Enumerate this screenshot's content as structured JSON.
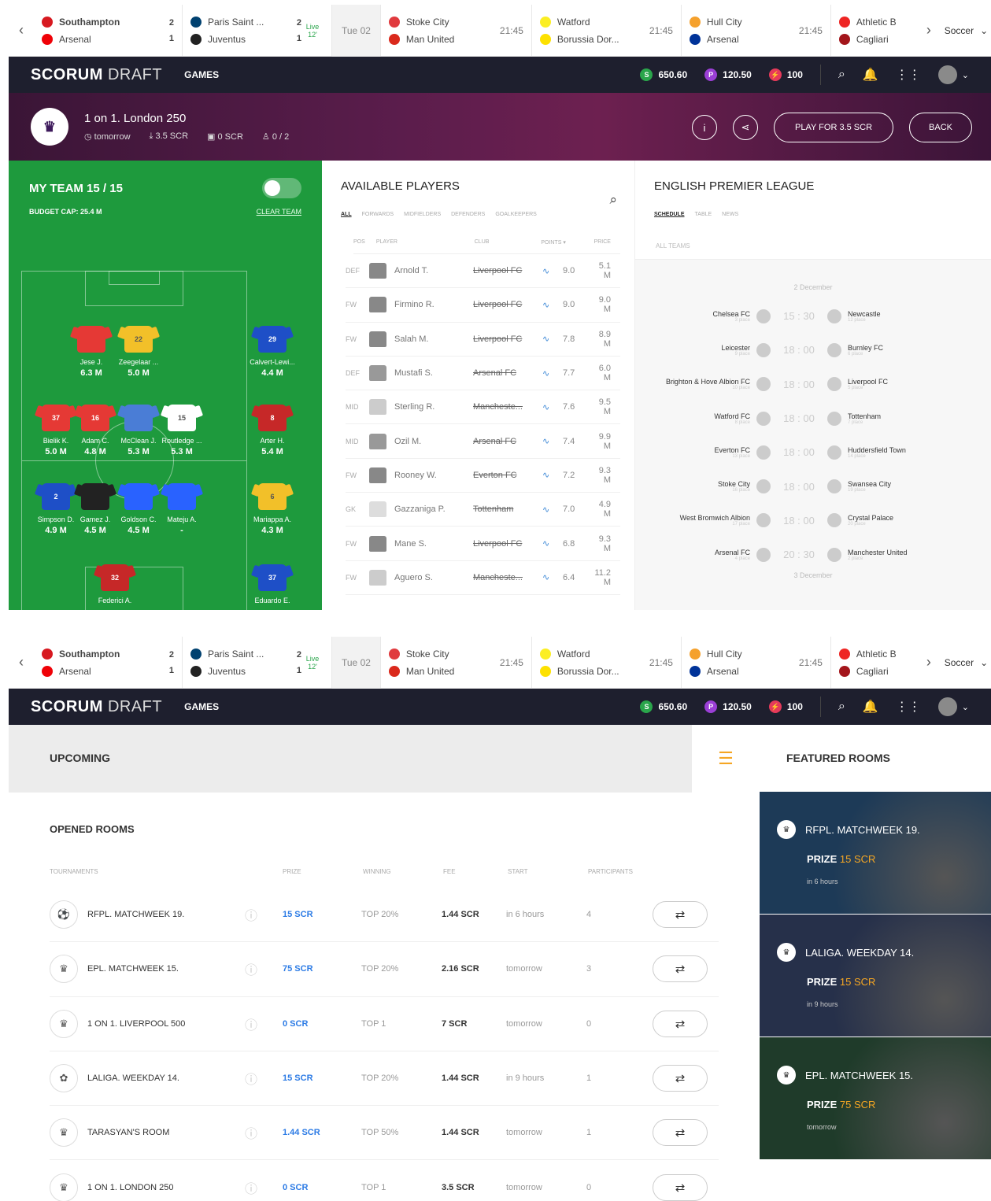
{
  "ticker": {
    "matches": [
      {
        "home": "Southampton",
        "away": "Arsenal",
        "home_score": "2",
        "away_score": "1",
        "status": "",
        "home_color": "#d71920",
        "away_color": "#ef0107"
      },
      {
        "home": "Paris Saint ...",
        "away": "Juventus",
        "home_score": "2",
        "away_score": "1",
        "status": "Live\n12'",
        "home_color": "#004170",
        "away_color": "#222222"
      },
      {
        "home": "Stoke City",
        "away": "Man United",
        "home_score": "",
        "away_score": "",
        "status": "21:45",
        "home_color": "#e03a3e",
        "away_color": "#da291c"
      },
      {
        "home": "Watford",
        "away": "Borussia Dor...",
        "home_score": "",
        "away_score": "",
        "status": "21:45",
        "home_color": "#fbee23",
        "away_color": "#fde100"
      },
      {
        "home": "Hull City",
        "away": "Arsenal",
        "home_score": "",
        "away_score": "",
        "status": "21:45",
        "home_color": "#f5a12d",
        "away_color": "#003399"
      },
      {
        "home": "Athletic B",
        "away": "Cagliari",
        "home_score": "",
        "away_score": "",
        "status": "",
        "home_color": "#ee2523",
        "away_color": "#a3151b"
      }
    ],
    "date_label": "Tue 02",
    "sport": "Soccer"
  },
  "nav": {
    "logo_bold": "SCORUM",
    "logo_light": "DRAFT",
    "games": "GAMES",
    "balance_scr": "650.60",
    "balance_p": "120.50",
    "balance_bolt": "100",
    "colors": {
      "scr": "#2aa54b",
      "p": "#9b3fd6",
      "bolt": "#e63a5a"
    }
  },
  "banner": {
    "title": "1 on 1. London 250",
    "start": "tomorrow",
    "fee": "3.5 SCR",
    "prize": "0 SCR",
    "participants": "0 / 2",
    "play_button": "PLAY FOR 3.5 SCR",
    "back_button": "BACK"
  },
  "team": {
    "title": "MY TEAM 15 / 15",
    "budget": "BUDGET CAP: 25.4 M",
    "clear": "CLEAR TEAM",
    "players": [
      {
        "name": "Jese J.",
        "price": "6.3 M",
        "num": "",
        "color": "#e53935"
      },
      {
        "name": "Zeegelaar ...",
        "price": "5.0 M",
        "num": "22",
        "color": "#f2c029"
      },
      {
        "name": "Calvert-Lewi...",
        "price": "4.4 M",
        "num": "29",
        "color": "#1e4fc7"
      },
      {
        "name": "Bielik K.",
        "price": "5.0 M",
        "num": "37",
        "color": "#e53935"
      },
      {
        "name": "Adam C.",
        "price": "4.8 M",
        "num": "16",
        "color": "#e53935"
      },
      {
        "name": "McClean J.",
        "price": "5.3 M",
        "num": "",
        "color": "#4a7dd6"
      },
      {
        "name": "Routledge ...",
        "price": "5.3 M",
        "num": "15",
        "color": "#ffffff"
      },
      {
        "name": "Arter H.",
        "price": "5.4 M",
        "num": "8",
        "color": "#c62828"
      },
      {
        "name": "Simpson D.",
        "price": "4.9 M",
        "num": "2",
        "color": "#1e4fc7"
      },
      {
        "name": "Gamez J.",
        "price": "4.5 M",
        "num": "",
        "color": "#222222"
      },
      {
        "name": "Goldson C.",
        "price": "4.5 M",
        "num": "",
        "color": "#2962ff"
      },
      {
        "name": "Mateju A.",
        "price": "-",
        "num": "",
        "color": "#2962ff"
      },
      {
        "name": "Mariappa A.",
        "price": "4.3 M",
        "num": "6",
        "color": "#f2c029"
      },
      {
        "name": "Federici A.",
        "price": "",
        "num": "32",
        "color": "#c62828"
      },
      {
        "name": "Eduardo E.",
        "price": "",
        "num": "37",
        "color": "#1e4fc7"
      }
    ]
  },
  "available": {
    "title": "AVAILABLE PLAYERS",
    "tabs": [
      "ALL",
      "FORWARDS",
      "MIDFIELDERS",
      "DEFENDERS",
      "GOALKEEPERS"
    ],
    "headers": [
      "POS",
      "PLAYER",
      "CLUB",
      "POINTS ▾",
      "PRICE"
    ],
    "players": [
      {
        "pos": "DEF",
        "name": "Arnold T.",
        "club": "Liverpool FC",
        "points": "9.0",
        "price": "5.1 M",
        "kit": "#888888"
      },
      {
        "pos": "FW",
        "name": "Firmino R.",
        "club": "Liverpool FC",
        "points": "9.0",
        "price": "9.0 M",
        "kit": "#888888"
      },
      {
        "pos": "FW",
        "name": "Salah M.",
        "club": "Liverpool FC",
        "points": "7.8",
        "price": "8.9 M",
        "kit": "#888888"
      },
      {
        "pos": "DEF",
        "name": "Mustafi S.",
        "club": "Arsenal FC",
        "points": "7.7",
        "price": "6.0 M",
        "kit": "#999999"
      },
      {
        "pos": "MID",
        "name": "Sterling R.",
        "club": "Mancheste...",
        "points": "7.6",
        "price": "9.5 M",
        "kit": "#cccccc"
      },
      {
        "pos": "MID",
        "name": "Ozil M.",
        "club": "Arsenal FC",
        "points": "7.4",
        "price": "9.9 M",
        "kit": "#999999"
      },
      {
        "pos": "FW",
        "name": "Rooney W.",
        "club": "Everton FC",
        "points": "7.2",
        "price": "9.3 M",
        "kit": "#888888"
      },
      {
        "pos": "GK",
        "name": "Gazzaniga P.",
        "club": "Tottenham",
        "points": "7.0",
        "price": "4.9 M",
        "kit": "#dddddd"
      },
      {
        "pos": "FW",
        "name": "Mane S.",
        "club": "Liverpool FC",
        "points": "6.8",
        "price": "9.3 M",
        "kit": "#888888"
      },
      {
        "pos": "FW",
        "name": "Aguero S.",
        "club": "Mancheste...",
        "points": "6.4",
        "price": "11.2 M",
        "kit": "#cccccc"
      }
    ]
  },
  "league": {
    "title": "ENGLISH PREMIER LEAGUE",
    "tabs": [
      "SCHEDULE",
      "TABLE",
      "NEWS"
    ],
    "filter": "ALL TEAMS",
    "date1": "2 December",
    "date2": "3 December",
    "fixtures": [
      {
        "home": "Chelsea FC",
        "home_place": "3 place",
        "time": "15 : 30",
        "away": "Newcastle",
        "away_place": "12 place"
      },
      {
        "home": "Leicester",
        "home_place": "9 place",
        "time": "18 : 00",
        "away": "Burnley FC",
        "away_place": "6 place"
      },
      {
        "home": "Brighton & Hove Albion FC",
        "home_place": "10 place",
        "time": "18 : 00",
        "away": "Liverpool FC",
        "away_place": "5 place"
      },
      {
        "home": "Watford FC",
        "home_place": "8 place",
        "time": "18 : 00",
        "away": "Tottenham",
        "away_place": "7 place"
      },
      {
        "home": "Everton FC",
        "home_place": "13 place",
        "time": "18 : 00",
        "away": "Huddersfield Town",
        "away_place": "14 place"
      },
      {
        "home": "Stoke City",
        "home_place": "16 place",
        "time": "18 : 00",
        "away": "Swansea City",
        "away_place": "19 place"
      },
      {
        "home": "West Bromwich Albion",
        "home_place": "17 place",
        "time": "18 : 00",
        "away": "Crystal Palace",
        "away_place": "20 place"
      },
      {
        "home": "Arsenal FC",
        "home_place": "4 place",
        "time": "20 : 30",
        "away": "Manchester United",
        "away_place": "2 place"
      }
    ]
  },
  "lobby": {
    "upcoming": "UPCOMING",
    "featured_title": "FEATURED ROOMS",
    "opened": "OPENED ROOMS",
    "headers": [
      "TOURNAMENTS",
      "PRIZE",
      "WINNING",
      "FEE",
      "START",
      "PARTICIPANTS"
    ],
    "rooms": [
      {
        "name": "RFPL. MATCHWEEK 19.",
        "prize": "15 SCR",
        "win": "TOP 20%",
        "fee": "1.44 SCR",
        "start": "in 6 hours",
        "part": "4"
      },
      {
        "name": "EPL. MATCHWEEK 15.",
        "prize": "75 SCR",
        "win": "TOP 20%",
        "fee": "2.16 SCR",
        "start": "tomorrow",
        "part": "3"
      },
      {
        "name": "1 ON 1. LIVERPOOL 500",
        "prize": "0 SCR",
        "win": "TOP 1",
        "fee": "7 SCR",
        "start": "tomorrow",
        "part": "0"
      },
      {
        "name": "LALIGA. WEEKDAY 14.",
        "prize": "15 SCR",
        "win": "TOP 20%",
        "fee": "1.44 SCR",
        "start": "in 9 hours",
        "part": "1"
      },
      {
        "name": "TARASYAN'S ROOM",
        "prize": "1.44 SCR",
        "win": "TOP 50%",
        "fee": "1.44 SCR",
        "start": "tomorrow",
        "part": "1"
      },
      {
        "name": "1 ON 1. LONDON 250",
        "prize": "0 SCR",
        "win": "TOP 1",
        "fee": "3.5 SCR",
        "start": "tomorrow",
        "part": "0"
      }
    ],
    "featured": [
      {
        "title": "RFPL. MATCHWEEK 19.",
        "prize_label": "PRIZE",
        "prize": "15 SCR",
        "when": "in 6 hours",
        "bg": "#1d3a57"
      },
      {
        "title": "LALIGA. WEEKDAY 14.",
        "prize_label": "PRIZE",
        "prize": "15 SCR",
        "when": "in 9 hours",
        "bg": "#26304a"
      },
      {
        "title": "EPL. MATCHWEEK 15.",
        "prize_label": "PRIZE",
        "prize": "75 SCR",
        "when": "tomorrow",
        "bg": "#1f3b2a"
      }
    ]
  }
}
